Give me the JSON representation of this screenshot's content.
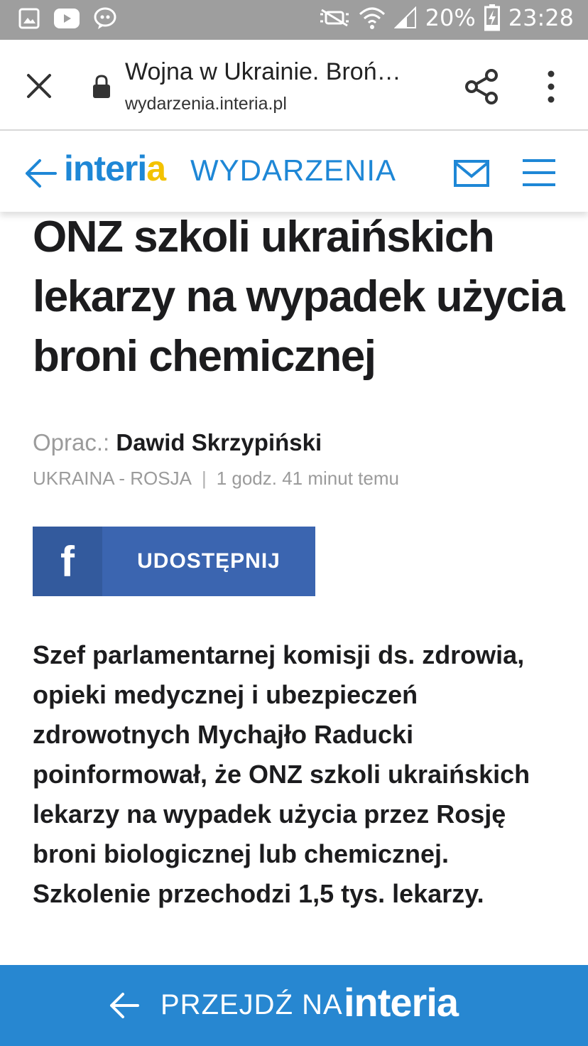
{
  "status_bar": {
    "battery_percent": "20%",
    "time": "23:28",
    "icons": [
      "gallery-icon",
      "youtube-icon",
      "messenger-icon",
      "mute-icon",
      "wifi-icon",
      "signal-icon",
      "battery-charging-icon"
    ]
  },
  "browser": {
    "page_title": "Wojna w Ukrainie. Broń…",
    "url": "wydarzenia.interia.pl"
  },
  "site_header": {
    "logo_main": "interi",
    "logo_accent": "a",
    "section": "WYDARZENIA"
  },
  "article": {
    "headline": "ONZ szkoli ukraińskich lekarzy na wypadek użycia broni chemicznej",
    "byline_label": "Oprac.:",
    "author": "Dawid Skrzypiński",
    "category": "UKRAINA - ROSJA",
    "separator": "|",
    "time_ago": "1 godz. 41 minut temu",
    "share_icon_letter": "f",
    "share_label": "UDOSTĘPNIJ",
    "lead": "Szef parlamentarnej komisji ds. zdrowia, opieki medycznej i ubezpieczeń zdrowotnych Mychajło Raducki poinformował, że ONZ szkoli ukraińskich lekarzy na wypadek użycia przez Rosję broni biologicznej lub chemicznej. Szkolenie przechodzi 1,5 tys. lekarzy."
  },
  "bottom_banner": {
    "text": "PRZEJDŹ NA",
    "logo": "interia"
  },
  "colors": {
    "brand_blue": "#1e87d6",
    "brand_yellow": "#f3c200",
    "facebook": "#3b65b0",
    "banner": "#2787d1"
  }
}
